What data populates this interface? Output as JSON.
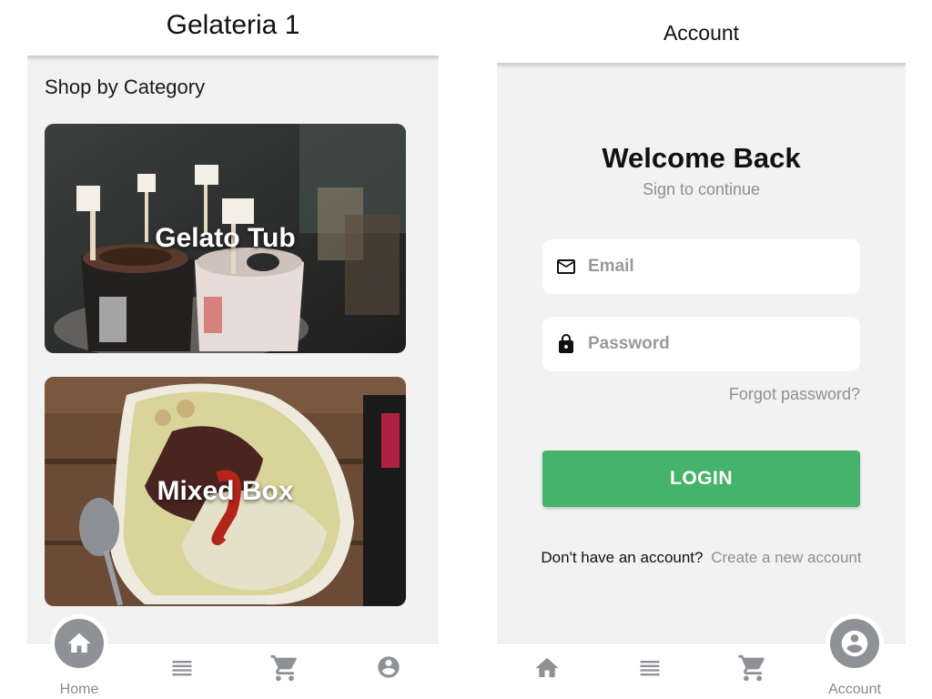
{
  "home": {
    "title": "Gelateria 1",
    "section_title": "Shop by Category",
    "categories": [
      {
        "label": "Gelato Tub"
      },
      {
        "label": "Mixed Box"
      }
    ],
    "nav": {
      "home_label": "Home"
    }
  },
  "account": {
    "title": "Account",
    "welcome": "Welcome Back",
    "subtitle": "Sign to continue",
    "email_placeholder": "Email",
    "password_placeholder": "Password",
    "forgot": "Forgot password?",
    "login_label": "LOGIN",
    "no_account": "Don't have an account?",
    "create_account": "Create a new account",
    "nav": {
      "account_label": "Account"
    }
  },
  "colors": {
    "accent": "#45b36b",
    "nav_icon": "#8e9297",
    "background": "#f2f2f2"
  },
  "icons": [
    "home-icon",
    "menu-icon",
    "cart-icon",
    "account-circle-icon",
    "email-icon",
    "lock-icon"
  ]
}
